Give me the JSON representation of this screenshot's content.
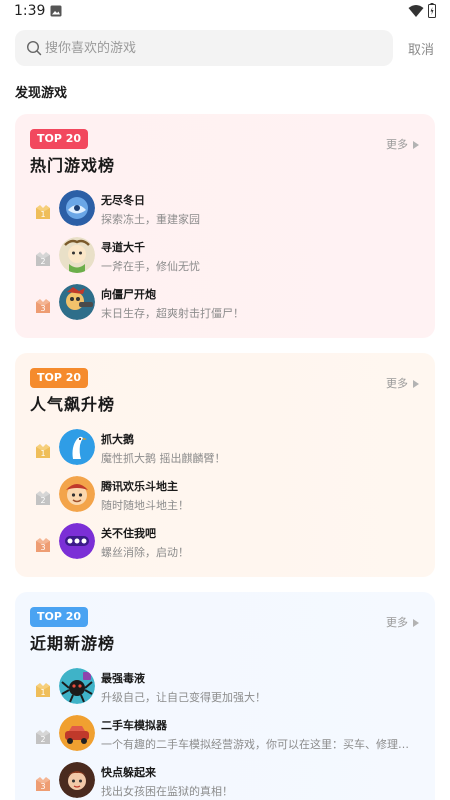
{
  "status_bar": {
    "time": "1:39"
  },
  "search": {
    "placeholder": "搜你喜欢的游戏",
    "value": "",
    "cancel_label": "取消"
  },
  "discover": {
    "title": "发现游戏"
  },
  "colors": {
    "badge_red": "#f2485e",
    "badge_orange": "#f58b2d",
    "badge_blue": "#4aa3f2"
  },
  "lists": [
    {
      "badge": "TOP 20",
      "title": "热门游戏榜",
      "more_label": "更多",
      "games": [
        {
          "rank": "1",
          "name": "无尽冬日",
          "desc": "探索冻土，重建家园"
        },
        {
          "rank": "2",
          "name": "寻道大千",
          "desc": "一斧在手，修仙无忧"
        },
        {
          "rank": "3",
          "name": "向僵尸开炮",
          "desc": "末日生存，超爽射击打僵尸！"
        }
      ]
    },
    {
      "badge": "TOP 20",
      "title": "人气飙升榜",
      "more_label": "更多",
      "games": [
        {
          "rank": "1",
          "name": "抓大鹅",
          "desc": "魔性抓大鹅 摇出麒麟臂！"
        },
        {
          "rank": "2",
          "name": "腾讯欢乐斗地主",
          "desc": "随时随地斗地主！"
        },
        {
          "rank": "3",
          "name": "关不住我吧",
          "desc": "螺丝消除，启动！"
        }
      ]
    },
    {
      "badge": "TOP 20",
      "title": "近期新游榜",
      "more_label": "更多",
      "games": [
        {
          "rank": "1",
          "name": "最强毒液",
          "desc": "升级自己，让自己变得更加强大！"
        },
        {
          "rank": "2",
          "name": "二手车模拟器",
          "desc": "一个有趣的二手车模拟经营游戏，你可以在这里：买车、修理、改装、卖车"
        },
        {
          "rank": "3",
          "name": "快点躲起来",
          "desc": "找出女孩困在监狱的真相！"
        }
      ]
    }
  ]
}
